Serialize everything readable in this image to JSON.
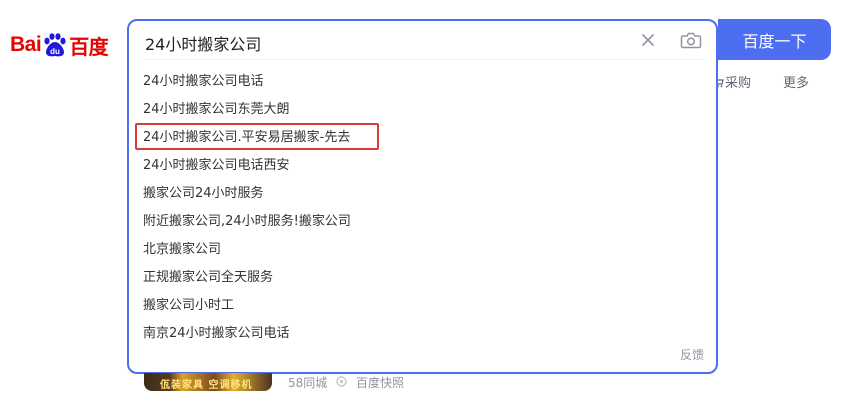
{
  "logo": {
    "text_left": "Bai",
    "text_right": "百度"
  },
  "search": {
    "query": "24小时搬家公司",
    "button_label": "百度一下"
  },
  "suggestions": [
    "24小时搬家公司电话",
    "24小时搬家公司东莞大朗",
    "24小时搬家公司.平安易居搬家-先去",
    "24小时搬家公司电话西安",
    "搬家公司24小时服务",
    "附近搬家公司,24小时服务!搬家公司",
    "北京搬家公司",
    "正规搬家公司全天服务",
    "搬家公司小时工",
    "南京24小时搬家公司电话"
  ],
  "highlighted_index": 2,
  "feedback_label": "反馈",
  "nav": {
    "caigou": "采购",
    "more": "更多"
  },
  "result": {
    "thumb_text": "佤装家具 空调移机",
    "source": "58同城",
    "snapshot": "百度快照"
  },
  "colors": {
    "brand_blue": "#4e6ef2",
    "logo_red": "#e10602",
    "paw_blue": "#2319dc",
    "highlight_red": "#d93b3b"
  },
  "icons": {
    "clear": "close-icon",
    "camera": "camera-icon",
    "paw": "baidu-paw-icon"
  }
}
